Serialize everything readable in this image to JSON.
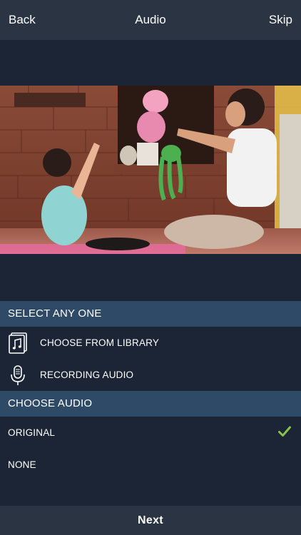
{
  "nav": {
    "back_label": "Back",
    "title": "Audio",
    "skip_label": "Skip"
  },
  "preview": {
    "image_description_icon": "video-preview"
  },
  "select_section": {
    "header": "SELECT ANY ONE",
    "items": [
      {
        "label": "CHOOSE FROM LIBRARY",
        "icon": "music-library-icon"
      },
      {
        "label": "RECORDING AUDIO",
        "icon": "microphone-icon"
      }
    ]
  },
  "audio_section": {
    "header": "CHOOSE AUDIO",
    "options": [
      {
        "label": "ORIGINAL",
        "selected": true
      },
      {
        "label": "NONE",
        "selected": false
      }
    ]
  },
  "footer": {
    "next_label": "Next"
  },
  "colors": {
    "background": "#1b2535",
    "nav_bar": "#2a3442",
    "section_header": "#2f4a66",
    "check_green": "#8bc34a"
  }
}
